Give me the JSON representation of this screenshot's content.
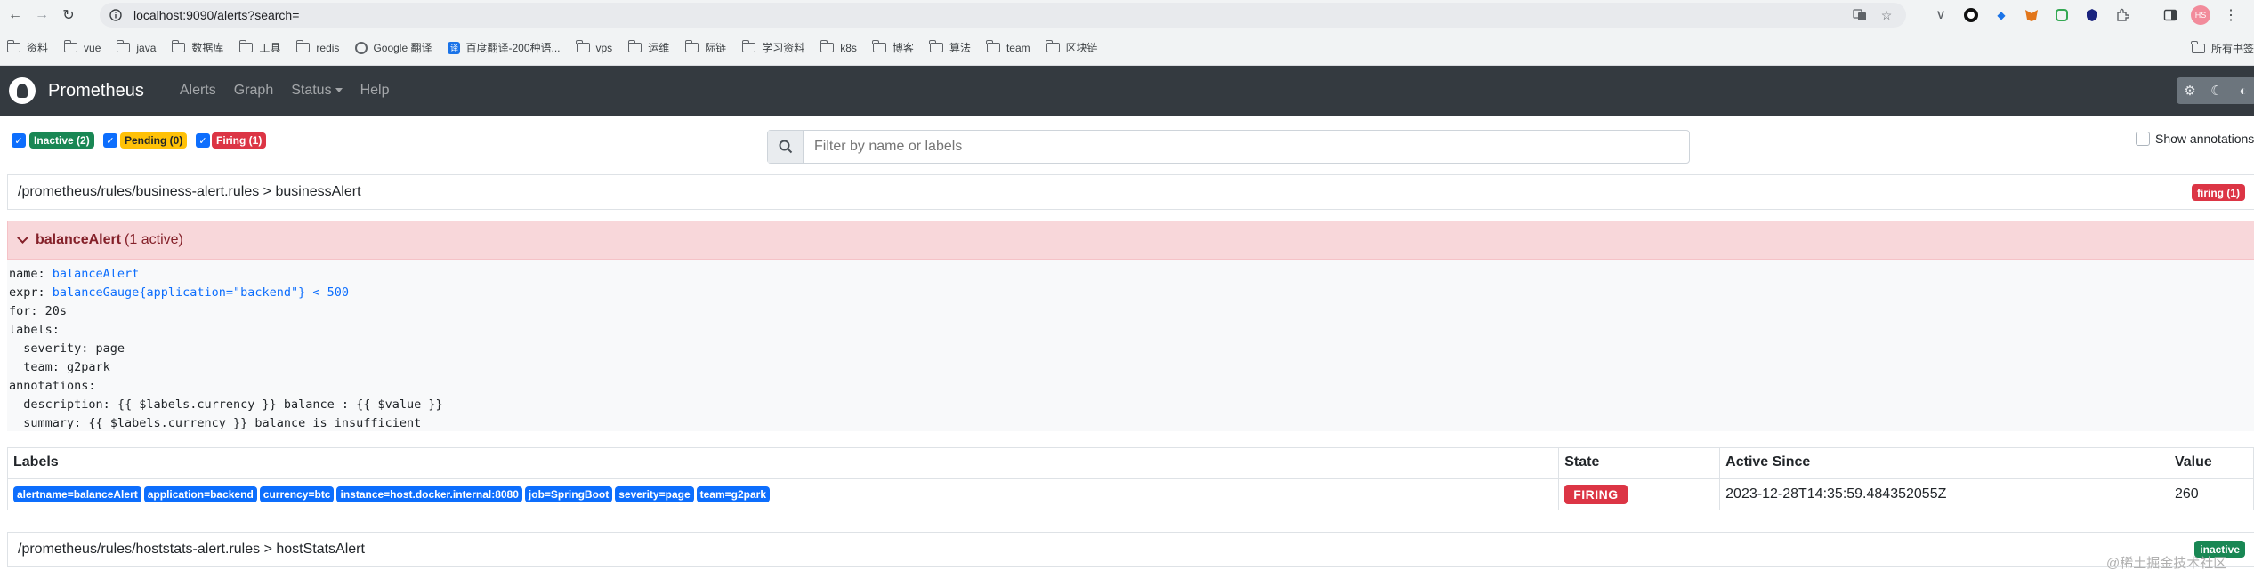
{
  "browser": {
    "url": "localhost:9090/alerts?search=",
    "profile_initials": "HS",
    "bookmarks": [
      {
        "label": "资料",
        "type": "folder"
      },
      {
        "label": "vue",
        "type": "folder"
      },
      {
        "label": "java",
        "type": "folder"
      },
      {
        "label": "数据库",
        "type": "folder"
      },
      {
        "label": "工具",
        "type": "folder"
      },
      {
        "label": "redis",
        "type": "folder"
      },
      {
        "label": "Google 翻译",
        "type": "google"
      },
      {
        "label": "百度翻译-200种语...",
        "type": "baidu"
      },
      {
        "label": "vps",
        "type": "folder"
      },
      {
        "label": "运维",
        "type": "folder"
      },
      {
        "label": "际链",
        "type": "folder"
      },
      {
        "label": "学习资料",
        "type": "folder"
      },
      {
        "label": "k8s",
        "type": "folder"
      },
      {
        "label": "博客",
        "type": "folder"
      },
      {
        "label": "算法",
        "type": "folder"
      },
      {
        "label": "team",
        "type": "folder"
      },
      {
        "label": "区块链",
        "type": "folder"
      }
    ],
    "bookmarks_right": "所有书签"
  },
  "navbar": {
    "brand": "Prometheus",
    "links": [
      "Alerts",
      "Graph",
      "Status",
      "Help"
    ]
  },
  "filters": {
    "inactive": "Inactive (2)",
    "pending": "Pending (0)",
    "firing": "Firing (1)",
    "search_placeholder": "Filter by name or labels",
    "show_annotations": "Show annotations"
  },
  "groups": [
    {
      "path": "/prometheus/rules/business-alert.rules > businessAlert",
      "status": "firing (1)",
      "alert": {
        "name": "balanceAlert",
        "active_count": "(1 active)",
        "definition": {
          "name_key": "name: ",
          "name_val": "balanceAlert",
          "expr_key": "expr: ",
          "expr_val": "balanceGauge{application=\"backend\"} < 500",
          "for_line": "for: 20s",
          "labels_key": "labels:",
          "severity_line": "  severity: page",
          "team_line": "  team: g2park",
          "annotations_key": "annotations:",
          "description_line": "  description: {{ $labels.currency }} balance : {{ $value }}",
          "summary_line": "  summary: {{ $labels.currency }} balance is insufficient"
        },
        "table": {
          "headers": [
            "Labels",
            "State",
            "Active Since",
            "Value"
          ],
          "row": {
            "labels": [
              "alertname=balanceAlert",
              "application=backend",
              "currency=btc",
              "instance=host.docker.internal:8080",
              "job=SpringBoot",
              "severity=page",
              "team=g2park"
            ],
            "state": "FIRING",
            "active_since": "2023-12-28T14:35:59.484352055Z",
            "value": "260"
          }
        }
      }
    },
    {
      "path": "/prometheus/rules/hoststats-alert.rules > hostStatsAlert",
      "status": "inactive"
    }
  ],
  "watermark": "@稀土掘金技术社区",
  "colors": {
    "navbar": "#343a40",
    "inactive": "#198754",
    "pending": "#ffc107",
    "firing": "#dc3545",
    "label": "#0d6efd",
    "alert_bg": "#f8d7da"
  }
}
